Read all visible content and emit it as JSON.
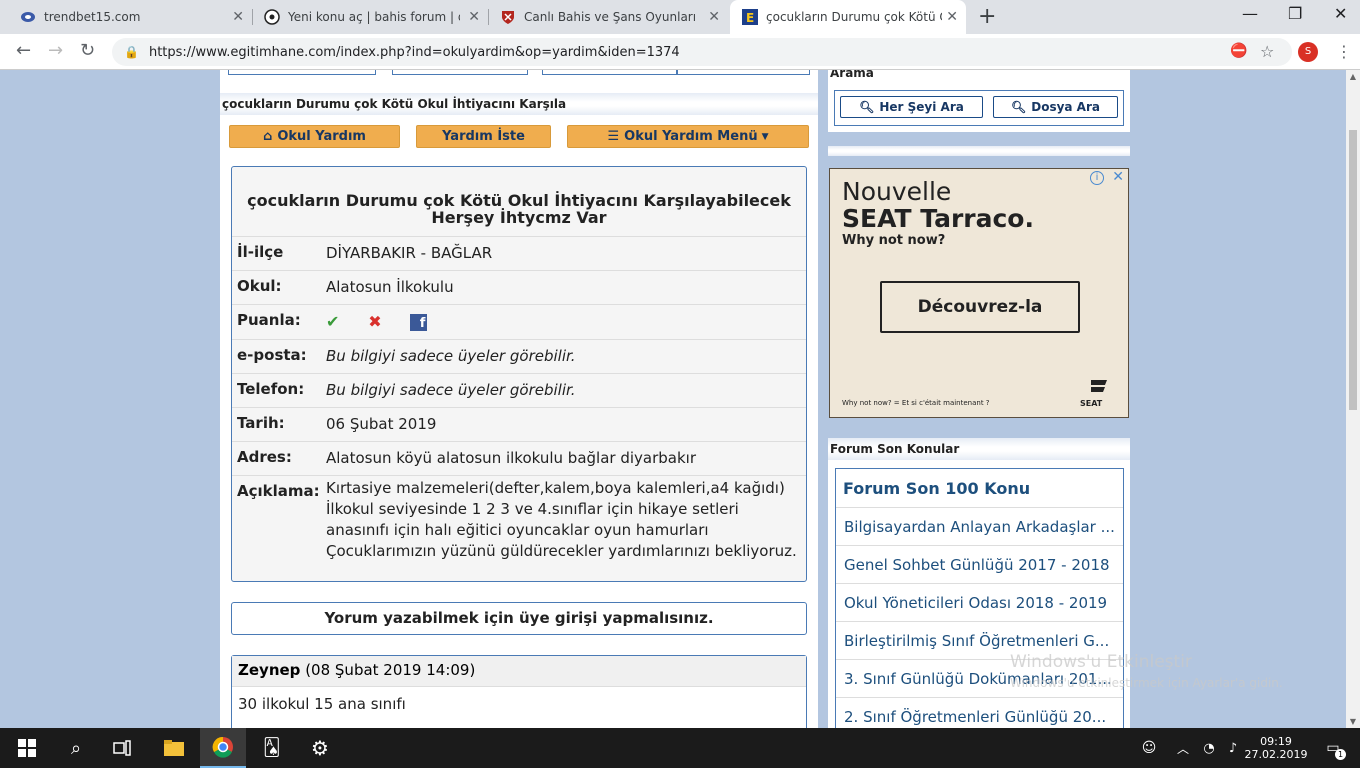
{
  "browser": {
    "tabs": [
      {
        "title": "trendbet15.com",
        "icon": "trendbet-favicon"
      },
      {
        "title": "Yeni konu aç | bahis forum | dene",
        "icon": "soccer-ball-favicon"
      },
      {
        "title": "Canlı Bahis ve Şans Oyunları sites",
        "icon": "shield-favicon"
      },
      {
        "title": "çocukların Durumu çok Kötü Oku",
        "icon": "egitimhane-favicon"
      }
    ],
    "url": "https://www.egitimhane.com/index.php?ind=okulyardim&op=yardim&iden=1374",
    "profile_initial": "S"
  },
  "main": {
    "section_title": "çocukların Durumu çok Kötü Okul İhtiyacını Karşıla",
    "buttons": {
      "okul_yardim": "Okul Yardım",
      "yardim_iste": "Yardım İste",
      "menu": "Okul Yardım Menü"
    },
    "card": {
      "title": "çocukların Durumu çok Kötü Okul İhtiyacını Karşılayabilecek Herşey İhtycmz Var",
      "rows": [
        {
          "label": "İl-ilçe",
          "value": "DİYARBAKIR - BAĞLAR"
        },
        {
          "label": "Okul:",
          "value": "Alatosun İlkokulu"
        },
        {
          "label": "Puanla:",
          "value": ""
        },
        {
          "label": "e-posta:",
          "value": "Bu bilgiyi sadece üyeler görebilir."
        },
        {
          "label": "Telefon:",
          "value": "Bu bilgiyi sadece üyeler görebilir."
        },
        {
          "label": "Tarih:",
          "value": "06 Şubat 2019"
        },
        {
          "label": "Adres:",
          "value": "Alatosun köyü alatosun ilkokulu bağlar diyarbakır"
        },
        {
          "label": "Açıklama:",
          "value": "Kırtasiye malzemeleri(defter,kalem,boya kalemleri,a4 kağıdı) İlkokul seviyesinde 1 2 3 ve 4.sınıflar için hikaye setleri anasınıfı için halı eğitici oyuncaklar oyun hamurları Çocuklarımızın yüzünü güldürecekler yardımlarınızı bekliyoruz."
        }
      ]
    },
    "login_notice": "Yorum yazabilmek için üye girişi yapmalısınız.",
    "comment": {
      "author": "Zeynep",
      "date": "(08 Şubat 2019 14:09)",
      "text": "30 ilkokul 15 ana sınıfı"
    }
  },
  "sidebar": {
    "search_title": "Arama",
    "search_all": "Her Şeyi Ara",
    "search_file": "Dosya Ara",
    "ad": {
      "line1": "Nouvelle",
      "line2": "SEAT Tarraco.",
      "line3": "Why not now?",
      "cta": "Découvrez-la",
      "footnote": "Why not now? = Et si c'était maintenant ?",
      "brand": "SEAT"
    },
    "forum_title": "Forum Son Konular",
    "forum_header": "Forum Son 100 Konu",
    "forum_links": [
      "Bilgisayardan Anlayan Arkadaşlar ...",
      "Genel Sohbet Günlüğü 2017 - 2018",
      "Okul Yöneticileri Odası 2018 - 2019",
      "Birleştirilmiş Sınıf Öğretmenleri G...",
      "3. Sınıf Günlüğü Dokümanları 201...",
      "2. Sınıf Öğretmenleri Günlüğü 20..."
    ]
  },
  "watermark": {
    "title": "Windows'u Etkinleştir",
    "subtitle": "Windows'u etkinleştirmek için Ayarlar'a gidin."
  },
  "taskbar": {
    "time": "09:19",
    "date": "27.02.2019",
    "notif_count": "1"
  }
}
